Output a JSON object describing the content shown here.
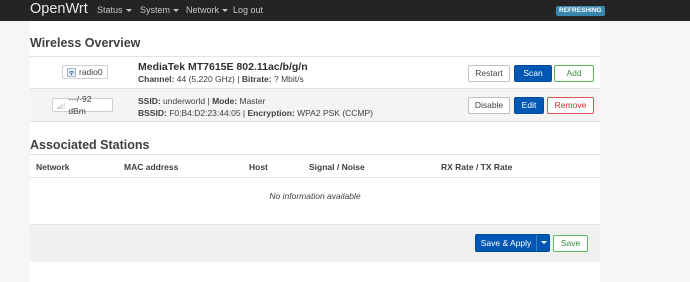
{
  "navbar": {
    "brand": "OpenWrt",
    "menus": [
      {
        "label": "Status",
        "has_caret": true
      },
      {
        "label": "System",
        "has_caret": true
      },
      {
        "label": "Network",
        "has_caret": true
      },
      {
        "label": "Log out",
        "has_caret": false
      }
    ],
    "badge": "REFRESHING"
  },
  "wireless": {
    "title": "Wireless Overview",
    "device": {
      "badge": "radio0",
      "name": "MediaTek MT7615E 802.11ac/b/g/n",
      "channel_label": "Channel:",
      "channel_value": "44 (5.220 GHz)",
      "sep": "|",
      "bitrate_label": "Bitrate:",
      "bitrate_value": "? Mbit/s",
      "buttons": {
        "restart": "Restart",
        "scan": "Scan",
        "add": "Add"
      }
    },
    "network": {
      "signal": "---/-92 dBm",
      "ssid_label": "SSID:",
      "ssid_value": "underworld",
      "sep": "|",
      "mode_label": "Mode:",
      "mode_value": "Master",
      "bssid_label": "BSSID:",
      "bssid_value": "F0:B4:D2:23:44:05",
      "encryption_label": "Encryption:",
      "encryption_value": "WPA2 PSK (CCMP)",
      "buttons": {
        "disable": "Disable",
        "edit": "Edit",
        "remove": "Remove"
      }
    }
  },
  "stations": {
    "title": "Associated Stations",
    "columns": [
      "Network",
      "MAC address",
      "Host",
      "Signal / Noise",
      "RX Rate / TX Rate"
    ],
    "empty_text": "No information available"
  },
  "footer": {
    "save_apply": "Save & Apply",
    "save": "Save"
  },
  "colors": {
    "primary": "#0058b3",
    "positive": "#5cb85c",
    "negative": "#d9534f",
    "navbar": "#242424",
    "badge": "#3a87ad"
  }
}
